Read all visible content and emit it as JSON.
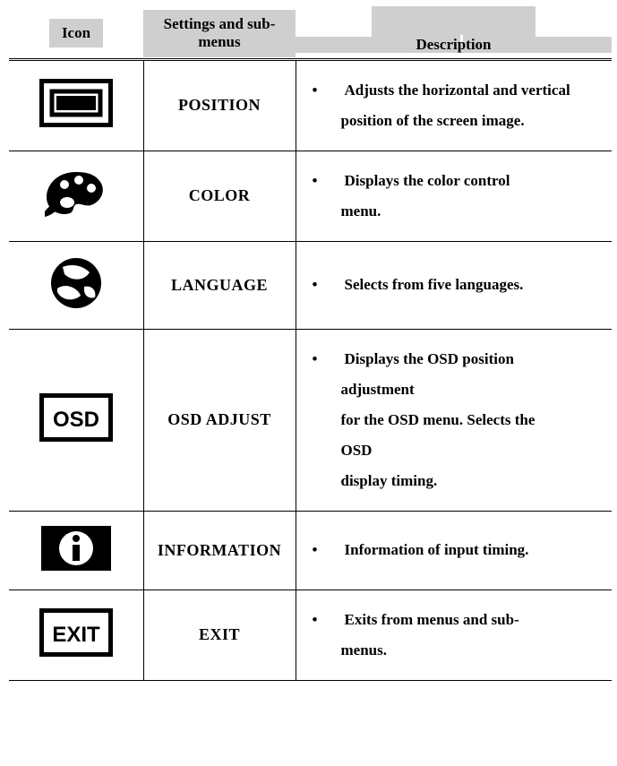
{
  "headers": {
    "icon": "Icon",
    "name": "Settings and sub-menus",
    "desc": "Description"
  },
  "rows": [
    {
      "icon_name": "position-icon",
      "name": "POSITION",
      "desc_lines": [
        {
          "type": "bullet",
          "text": "Adjusts the horizontal and vertical"
        },
        {
          "type": "cont",
          "text": "position of the screen image."
        }
      ]
    },
    {
      "icon_name": "color-icon",
      "name": "COLOR",
      "desc_lines": [
        {
          "type": "bullet",
          "text": "Displays the color control"
        },
        {
          "type": "cont",
          "text": "menu."
        }
      ]
    },
    {
      "icon_name": "language-icon",
      "name": "LANGUAGE",
      "desc_lines": [
        {
          "type": "bullet",
          "text": "Selects from five languages."
        }
      ]
    },
    {
      "icon_name": "osd-adjust-icon",
      "name": "OSD ADJUST",
      "desc_lines": [
        {
          "type": "bullet",
          "text": "Displays the OSD position"
        },
        {
          "type": "cont",
          "text": "adjustment"
        },
        {
          "type": "cont",
          "text": "for the OSD menu. Selects the"
        },
        {
          "type": "cont",
          "text": "OSD"
        },
        {
          "type": "cont",
          "text": "display timing."
        }
      ]
    },
    {
      "icon_name": "information-icon",
      "name": "INFORMATION",
      "desc_lines": [
        {
          "type": "bullet",
          "text": "Information of input timing."
        }
      ]
    },
    {
      "icon_name": "exit-icon",
      "name": "EXIT",
      "desc_lines": [
        {
          "type": "bullet",
          "text": "Exits from menus and sub-"
        },
        {
          "type": "cont",
          "text": "menus."
        }
      ]
    }
  ]
}
